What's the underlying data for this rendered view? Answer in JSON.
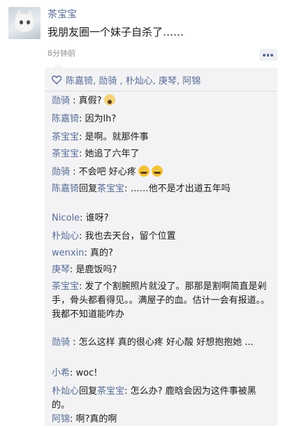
{
  "post": {
    "username": "茶宝宝",
    "text": "我朋友圈一个妹子自杀了……",
    "time": "8分钟前",
    "likes": "陈嘉锜, 勋骑 , 朴灿心, 庚琴, 阿锦"
  },
  "comments": [
    {
      "name": "勋骑",
      "sep": " : ",
      "text": "真假?",
      "emoji": "scream-face-icon"
    },
    {
      "name": "陈嘉锜",
      "sep": ": ",
      "text": "因为lh?"
    },
    {
      "name": "茶宝宝",
      "sep": ": ",
      "text": "是啊。就那件事"
    },
    {
      "name": "茶宝宝",
      "sep": ": ",
      "text": "她追了六年了"
    },
    {
      "name": "勋骑",
      "sep": " : ",
      "text": "不会吧 好心疼",
      "emoji": "crying-face-icon"
    },
    {
      "name": "陈嘉锜",
      "reply": "回复",
      "reply_to": "茶宝宝",
      "sep": ": ",
      "text": "……他不是才出道五年吗"
    },
    {
      "name": "Nicole",
      "sep": ": ",
      "text": "谁呀?"
    },
    {
      "name": "朴灿心",
      "sep": ": ",
      "text": "我也去天台，留个位置"
    },
    {
      "name": "wenxin",
      "sep": ": ",
      "text": "真的?"
    },
    {
      "name": "庚琴",
      "sep": ": ",
      "text": "是鹿饭吗?"
    },
    {
      "name": "茶宝宝",
      "sep": ": ",
      "text": "发了个割腕照片就没了。那那是割啊简直是剁手，骨头都看得见。。满屋子的血。估计一会有报道。。我都不知道能咋办"
    },
    {
      "name": "勋骑",
      "sep": " : ",
      "text": "怎么这样 真的很心疼 好心酸 好想抱抱她 ..."
    },
    {
      "name": "小希",
      "sep": ": ",
      "text": "woc!"
    },
    {
      "name": "朴灿心",
      "reply": "回复",
      "reply_to": "茶宝宝",
      "sep": ": ",
      "text": "怎么办? 鹿晗会因为这件事被黑的。"
    },
    {
      "name": "阿锦",
      "sep": ": ",
      "text": "啊?真的啊"
    }
  ],
  "colors": {
    "link": "#576b95",
    "comment_bg": "#f3f3f5"
  }
}
